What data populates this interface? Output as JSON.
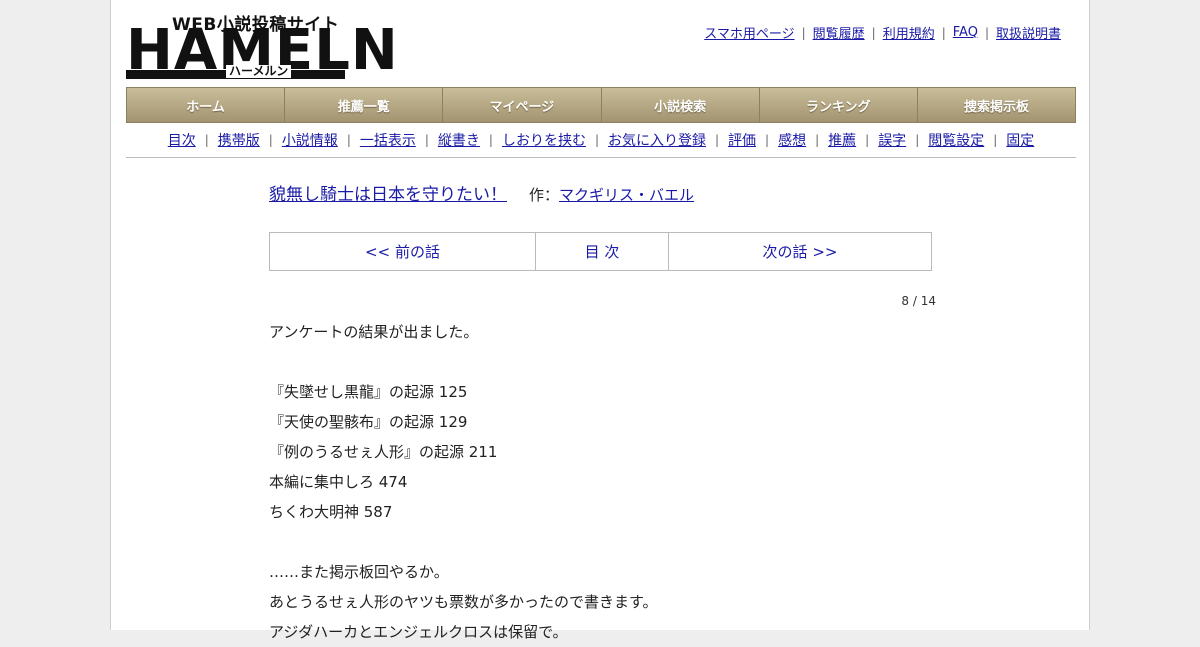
{
  "logo": {
    "tagline": "WEB小説投稿サイト",
    "main": "HAMELN",
    "kana": "ハーメルン"
  },
  "toplinks": [
    "スマホ用ページ",
    "閲覧履歴",
    "利用規約",
    "FAQ",
    "取扱説明書"
  ],
  "mainnav": [
    "ホーム",
    "推薦一覧",
    "マイページ",
    "小説検索",
    "ランキング",
    "捜索掲示板"
  ],
  "subnav": [
    "目次",
    "携帯版",
    "小説情報",
    "一括表示",
    "縦書き",
    "しおりを挟む",
    "お気に入り登録",
    "評価",
    "感想",
    "推薦",
    "誤字",
    "閲覧設定",
    "固定"
  ],
  "novel": {
    "title": "貌無し騎士は日本を守りたい！",
    "author_prefix": "作：",
    "author": "マクギリス・バエル"
  },
  "episode_nav": {
    "prev": "<< 前の話",
    "toc": "目 次",
    "next": "次の話 >>"
  },
  "page_count": "8 / 14",
  "body_lines": [
    "アンケートの結果が出ました。",
    "",
    "『失墜せし黒龍』の起源 125",
    "『天使の聖骸布』の起源 129",
    "『例のうるせぇ人形』の起源 211",
    "本編に集中しろ 474",
    "ちくわ大明神 587",
    "",
    "……また掲示板回やるか。",
    "あとうるせぇ人形のヤツも票数が多かったので書きます。",
    "アジダハーカとエンジェルクロスは保留で。"
  ]
}
